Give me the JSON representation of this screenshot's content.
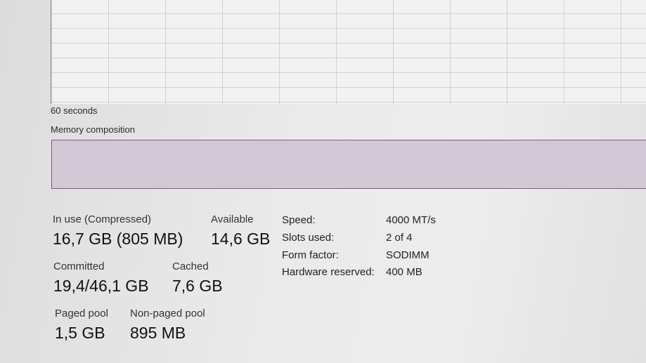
{
  "graph": {
    "time_label": "60 seconds"
  },
  "composition": {
    "label": "Memory composition"
  },
  "stats": {
    "in_use": {
      "label": "In use (Compressed)",
      "value": "16,7 GB (805 MB)"
    },
    "available": {
      "label": "Available",
      "value": "14,6 GB"
    },
    "committed": {
      "label": "Committed",
      "value": "19,4/46,1 GB"
    },
    "cached": {
      "label": "Cached",
      "value": "7,6 GB"
    },
    "paged_pool": {
      "label": "Paged pool",
      "value": "1,5 GB"
    },
    "non_paged_pool": {
      "label": "Non-paged pool",
      "value": "895 MB"
    }
  },
  "details": [
    {
      "label": "Speed:",
      "value": "4000 MT/s"
    },
    {
      "label": "Slots used:",
      "value": "2 of 4"
    },
    {
      "label": "Form factor:",
      "value": "SODIMM"
    },
    {
      "label": "Hardware reserved:",
      "value": "400 MB"
    }
  ],
  "colors": {
    "composition_fill": "#d2c8d6",
    "composition_border": "#7a5c86"
  }
}
